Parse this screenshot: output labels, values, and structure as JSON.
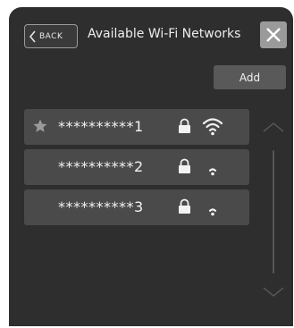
{
  "header": {
    "back_label": "BACK",
    "title": "Available Wi-Fi Networks",
    "close_icon": "close-icon"
  },
  "toolbar": {
    "add_label": "Add"
  },
  "networks": [
    {
      "ssid": "**********1",
      "favorite": true,
      "secured": true,
      "signal": "strong"
    },
    {
      "ssid": "**********2",
      "favorite": false,
      "secured": true,
      "signal": "weak"
    },
    {
      "ssid": "**********3",
      "favorite": false,
      "secured": true,
      "signal": "weak"
    }
  ],
  "colors": {
    "background": "#2e2e2e",
    "row": "#4a4a4a",
    "close_button": "#9a9a9a",
    "add_button": "#595959",
    "text": "#f2f2f2"
  }
}
